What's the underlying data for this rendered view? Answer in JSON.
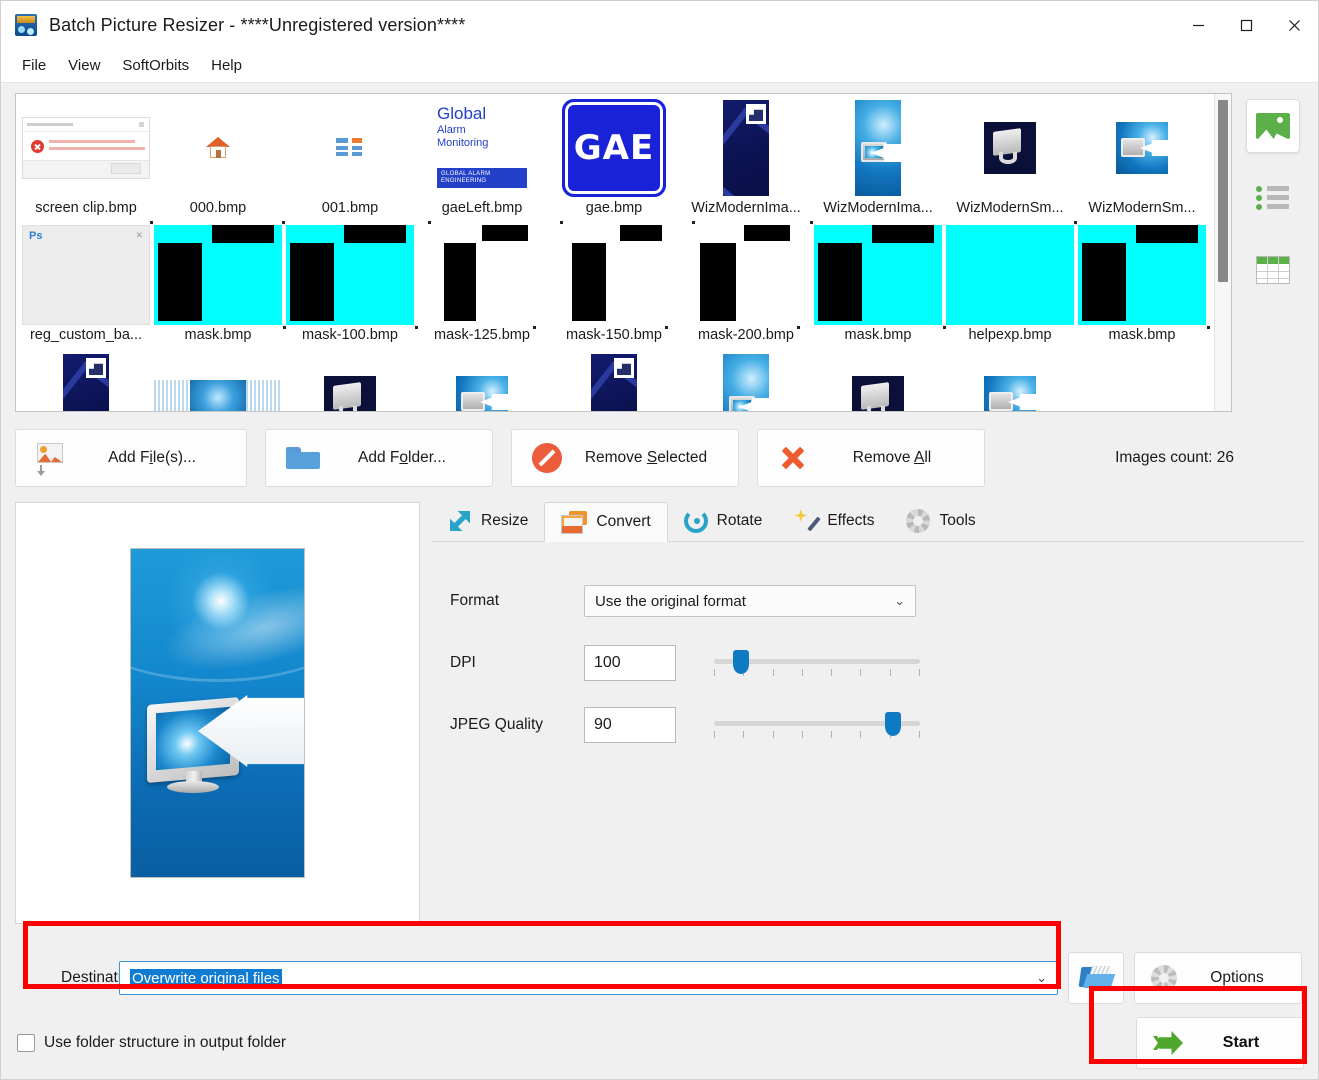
{
  "window": {
    "title": "Batch Picture Resizer - ****Unregistered version****",
    "icon": "app-icon",
    "controls": {
      "minimize": "–",
      "maximize": "□",
      "close": "✕"
    }
  },
  "menu": {
    "items": [
      "File",
      "View",
      "SoftOrbits",
      "Help"
    ]
  },
  "thumbnails": {
    "row1": [
      {
        "label": "screen clip.bmp",
        "art": "dialog"
      },
      {
        "label": "000.bmp",
        "art": "home"
      },
      {
        "label": "001.bmp",
        "art": "tiles"
      },
      {
        "label": "gaeLeft.bmp",
        "art": "gae-left"
      },
      {
        "label": "gae.bmp",
        "art": "gae",
        "selected": true
      },
      {
        "label": "WizModernIma...",
        "art": "wiz-tall"
      },
      {
        "label": "WizModernIma...",
        "art": "wiz-blue"
      },
      {
        "label": "WizModernSm...",
        "art": "wiz-sm"
      },
      {
        "label": "WizModernSm...",
        "art": "wiz-sm2"
      }
    ],
    "row2": [
      {
        "label": "reg_custom_ba...",
        "art": "ps"
      },
      {
        "label": "mask.bmp",
        "art": "mask-full"
      },
      {
        "label": "mask-100.bmp",
        "art": "mask-full"
      },
      {
        "label": "mask-125.bmp",
        "art": "mask-bars"
      },
      {
        "label": "mask-150.bmp",
        "art": "mask-bars"
      },
      {
        "label": "mask-200.bmp",
        "art": "mask-bars"
      },
      {
        "label": "mask.bmp",
        "art": "mask-full"
      },
      {
        "label": "helpexp.bmp",
        "art": "mask-plain"
      },
      {
        "label": "mask.bmp",
        "art": "mask-full"
      }
    ]
  },
  "gae_left_text": {
    "line1": "Global",
    "line2": "Alarm",
    "line3": "Monitoring",
    "badge": "GLOBAL ALARM ENGINEERING"
  },
  "gae_text": "GAE",
  "ps_text": {
    "label": "Ps",
    "close": "✕"
  },
  "view_modes": [
    {
      "name": "thumbnails-view",
      "icon": "image-icon",
      "active": true
    },
    {
      "name": "list-view",
      "icon": "list-icon",
      "active": false
    },
    {
      "name": "details-view",
      "icon": "grid-icon",
      "active": false
    }
  ],
  "actions": {
    "add_files": {
      "pre": "Add F",
      "mnemonic": "i",
      "post": "le(s)..."
    },
    "add_folder": {
      "pre": "Add F",
      "mnemonic": "o",
      "post": "lder..."
    },
    "remove_selected": {
      "pre": "Remove ",
      "mnemonic": "S",
      "post": "elected"
    },
    "remove_all": {
      "pre": "Remove ",
      "mnemonic": "A",
      "post": "ll"
    },
    "images_count": "Images count: 26"
  },
  "tabs": [
    {
      "label": "Resize",
      "icon": "resize-icon",
      "active": false
    },
    {
      "label": "Convert",
      "icon": "convert-icon",
      "active": true
    },
    {
      "label": "Rotate",
      "icon": "rotate-icon",
      "active": false
    },
    {
      "label": "Effects",
      "icon": "effects-icon",
      "active": false
    },
    {
      "label": "Tools",
      "icon": "tools-icon",
      "active": false
    }
  ],
  "convert_panel": {
    "format_label": "Format",
    "format_value": "Use the original format",
    "dpi_label": "DPI",
    "dpi_value": "100",
    "dpi_percent": 13,
    "jpeg_label": "JPEG Quality",
    "jpeg_value": "90",
    "jpeg_percent": 87,
    "chevron": "⌄"
  },
  "destination": {
    "label": "Destination",
    "value": "Overwrite original files",
    "chevron": "⌄",
    "browse_icon": "open-folder-icon"
  },
  "options_button": {
    "label": "Options",
    "icon": "gear-icon"
  },
  "folder_structure": {
    "label": "Use folder structure in output folder",
    "checked": false
  },
  "start_button": {
    "label": "Start",
    "icon": "green-arrow-icon"
  },
  "annotations": {
    "color": "#ff0000",
    "boxes": [
      "destination-highlight",
      "start-highlight"
    ]
  }
}
